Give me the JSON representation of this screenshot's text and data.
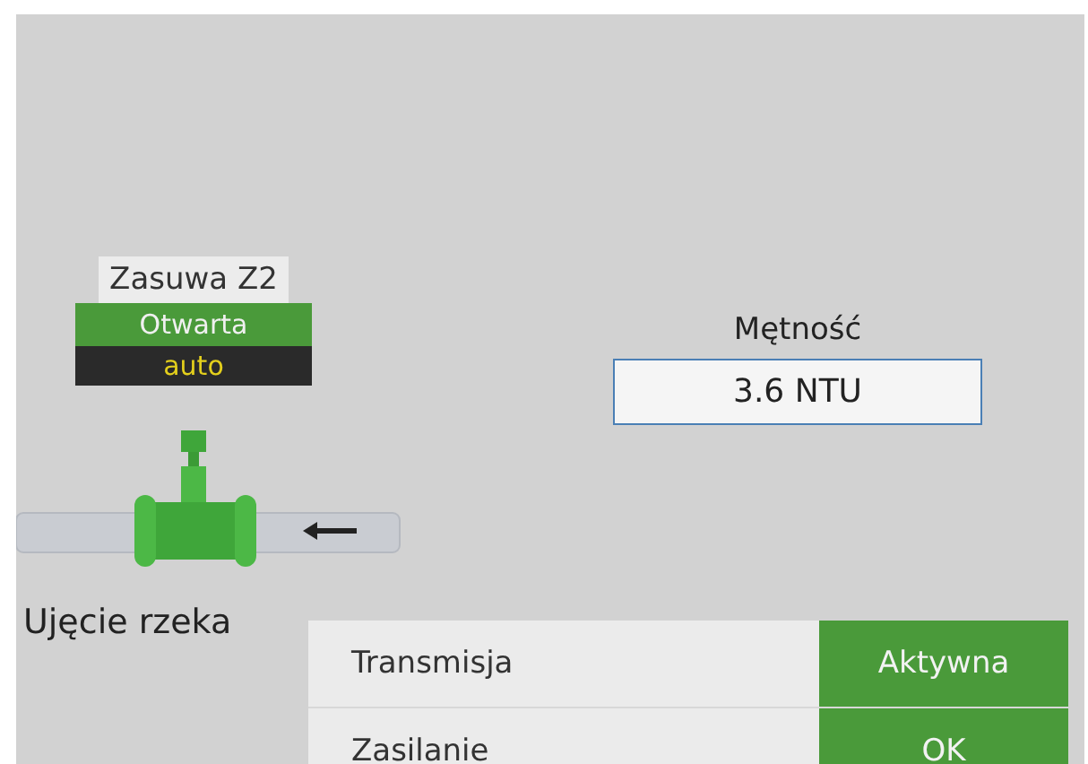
{
  "valve": {
    "title": "Zasuwa Z2",
    "status": "Otwarta",
    "open": true,
    "mode": "auto"
  },
  "intake": {
    "label": "Ujęcie rzeka"
  },
  "turbidity": {
    "label": "Mętność",
    "value": "3.6 NTU"
  },
  "status_rows": [
    {
      "label": "Transmisja",
      "value": "Aktywna",
      "ok": true
    },
    {
      "label": "Zasilanie",
      "value": "OK",
      "ok": true
    }
  ]
}
